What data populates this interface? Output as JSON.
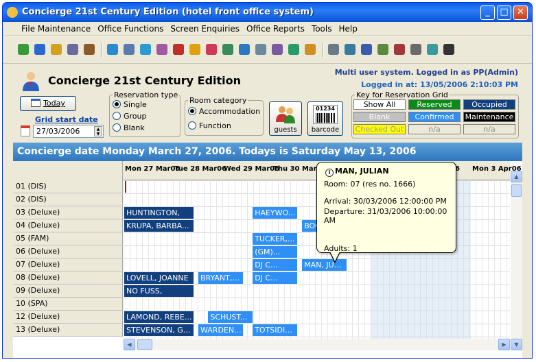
{
  "window": {
    "title": "Concierge 21st Century Edition (hotel front office system)"
  },
  "menu": [
    "File Maintenance",
    "Office Functions",
    "Screen Enquiries",
    "Office Reports",
    "Tools",
    "Help"
  ],
  "toolbar_icons": [
    "check-icon",
    "chart-icon",
    "lock-icon",
    "database-icon",
    "people-icon",
    "user-db-icon",
    "server-icon",
    "globe-icon",
    "percent-icon",
    "cube-icon",
    "coin-icon",
    "gift-icon",
    "image-icon",
    "world-icon",
    "network-icon",
    "film-icon",
    "globe-arrow-icon",
    "package-icon",
    "printer-icon",
    "clock-icon",
    "broom-icon",
    "calculator-icon",
    "list-icon",
    "key-icon",
    "envelope-icon",
    "barcode-icon"
  ],
  "header": {
    "app_title": "Concierge 21st Century Edition",
    "status_line1": "Multi user system. Logged in as PP(Admin)",
    "status_line2": "Logged in at: 13/05/2006 2:10:03 PM"
  },
  "controls": {
    "today_label": "Today",
    "grid_start_label": "Grid start date",
    "grid_start_value": "27/03/2006",
    "reservation_type": {
      "legend": "Reservation type",
      "options": [
        "Single",
        "Group",
        "Blank"
      ],
      "selected": "Single"
    },
    "room_category": {
      "legend": "Room category",
      "options": [
        "Accommodation",
        "Function"
      ],
      "selected": "Accommodation"
    },
    "guests_label": "guests",
    "barcode_label": "barcode",
    "barcode_digits": "01234"
  },
  "key": {
    "legend": "Key for Reservation Grid",
    "show_all": "Show All",
    "reserved": "Reserved",
    "occupied": "Occupied",
    "blank": "Blank",
    "confirmed": "Confirmed",
    "maintenance": "Maintenance",
    "checked_out": "Checked Out",
    "na1": "n/a",
    "na2": "n/a",
    "colors": {
      "reserved": "#0b8a1a",
      "occupied": "#12407e",
      "blank": "#c0c0c0",
      "confirmed": "#2f8ff5",
      "maintenance": "#000000",
      "checked_out": "#ffff00"
    }
  },
  "banner": "Concierge date Monday March 27, 2006. Todays is Saturday May 13, 2006",
  "grid": {
    "days": [
      "Mon 27 Mar06",
      "Tue 28 Mar06",
      "Wed 29 Mar06",
      "Thu 30 Mar06",
      "06",
      "Mon 3 Apr06"
    ],
    "rooms": [
      "01 (DIS)",
      "02 (DIS)",
      "03 (Deluxe)",
      "04 (Deluxe)",
      "05 (FAM)",
      "06 (Deluxe)",
      "07 (Deluxe)",
      "08 (Deluxe)",
      "09 (Deluxe)",
      "10 (SPA)",
      "12 (Deluxe)",
      "13 (Deluxe)"
    ],
    "reservations": [
      {
        "label": "HUNTINGTON,",
        "style": "dark",
        "row": 2,
        "start": 0,
        "span": 14
      },
      {
        "label": "HAEYWO...",
        "style": "light",
        "row": 2,
        "start": 26,
        "span": 9
      },
      {
        "label": "KRUPA, BARBA...",
        "style": "dark",
        "row": 3,
        "start": 0,
        "span": 14
      },
      {
        "label": "BOC",
        "style": "light",
        "row": 3,
        "start": 36,
        "span": 4
      },
      {
        "label": "TUCKER,...",
        "style": "light",
        "row": 4,
        "start": 26,
        "span": 9
      },
      {
        "label": "(GM)...",
        "style": "light",
        "row": 5,
        "start": 26,
        "span": 9
      },
      {
        "label": "DJ C...",
        "style": "light",
        "row": 6,
        "start": 26,
        "span": 9
      },
      {
        "label": "MAN, JU...",
        "style": "light",
        "row": 6,
        "start": 36,
        "span": 9
      },
      {
        "label": "LOVELL, JOANNE",
        "style": "dark",
        "row": 7,
        "start": 0,
        "span": 14
      },
      {
        "label": "BRYANT,...",
        "style": "light",
        "row": 7,
        "start": 15,
        "span": 9
      },
      {
        "label": "DJ C...",
        "style": "light",
        "row": 7,
        "start": 26,
        "span": 9
      },
      {
        "label": "NO FUSS,",
        "style": "dark",
        "row": 8,
        "start": 0,
        "span": 14
      },
      {
        "label": "LAMOND, REBE...",
        "style": "dark",
        "row": 10,
        "start": 0,
        "span": 14
      },
      {
        "label": "SCHUST...",
        "style": "light",
        "row": 10,
        "start": 17,
        "span": 9
      },
      {
        "label": "STEVENSON, G...",
        "style": "dark",
        "row": 11,
        "start": 0,
        "span": 14
      },
      {
        "label": "WARDEN...",
        "style": "light",
        "row": 11,
        "start": 15,
        "span": 9
      },
      {
        "label": "TOTSIDI...",
        "style": "light",
        "row": 11,
        "start": 26,
        "span": 9
      }
    ]
  },
  "tooltip": {
    "name": "MAN, JULIAN",
    "room": "Room: 07  (res no. 1666)",
    "arrival": "Arrival: 30/03/2006 12:00:00 PM",
    "departure": "Departure: 31/03/2006 10:00:00 AM",
    "adults": "Adults: 1"
  }
}
